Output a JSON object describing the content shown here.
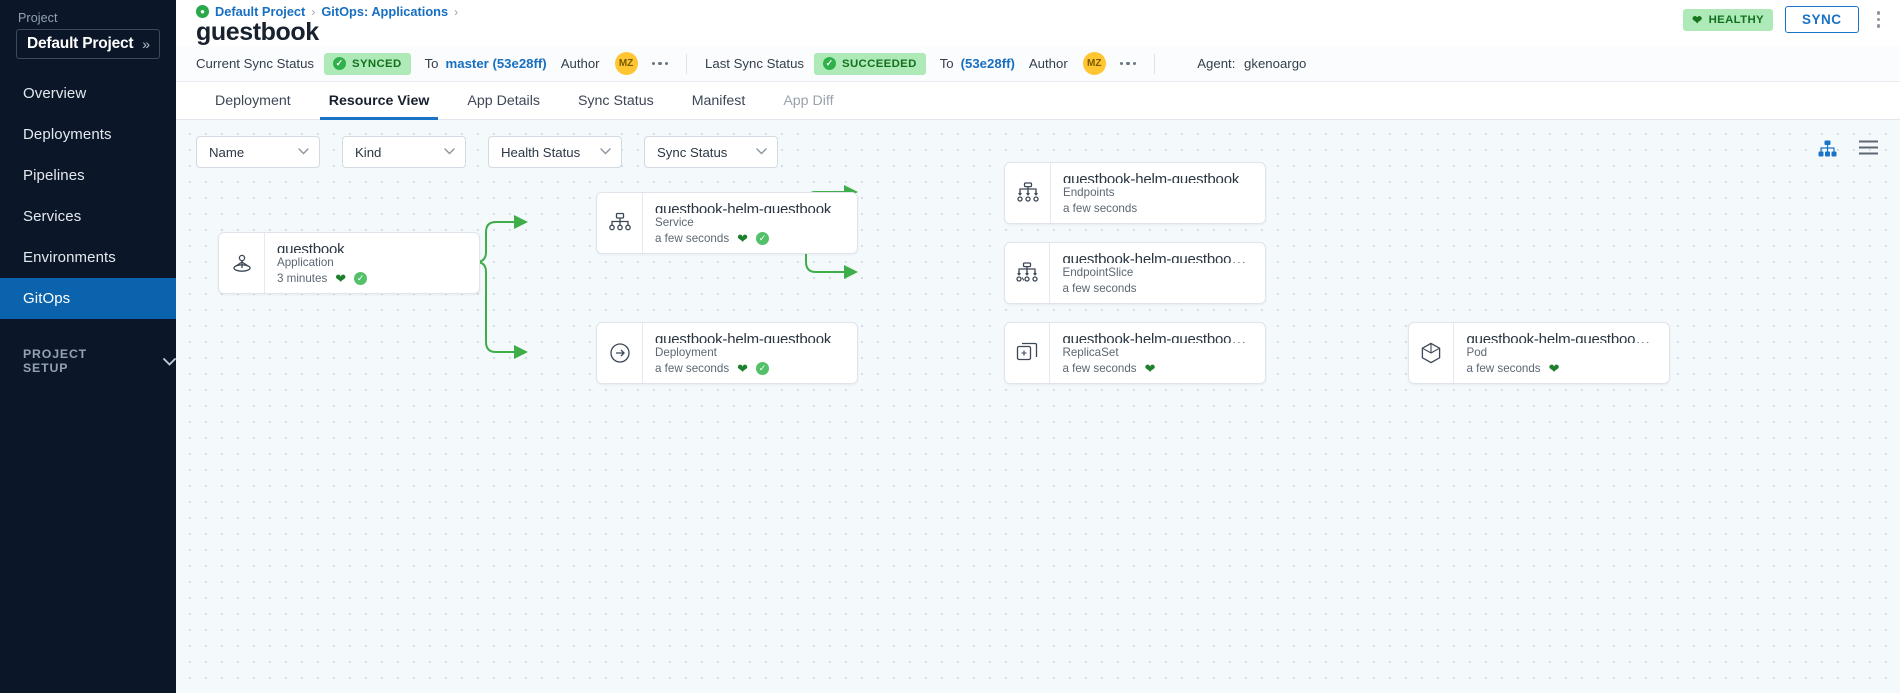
{
  "sidebar": {
    "project_label": "Project",
    "project_name": "Default Project",
    "expand_glyph": "»",
    "items": [
      {
        "label": "Overview"
      },
      {
        "label": "Deployments"
      },
      {
        "label": "Pipelines"
      },
      {
        "label": "Services"
      },
      {
        "label": "Environments"
      },
      {
        "label": "GitOps"
      }
    ],
    "active_item": "GitOps",
    "setup_label": "PROJECT SETUP",
    "setup_caret": "⌄"
  },
  "breadcrumb": {
    "items": [
      {
        "label": "Default Project"
      },
      {
        "label": "GitOps: Applications"
      }
    ],
    "separator": "›"
  },
  "header": {
    "title": "guestbook",
    "health_badge": "HEALTHY",
    "sync_button": "SYNC"
  },
  "status": {
    "current_sync_label": "Current Sync Status",
    "current_sync_value": "SYNCED",
    "current_to_label": "To",
    "current_to_value": "master (53e28ff)",
    "current_author_label": "Author",
    "current_author_initials": "MZ",
    "last_sync_label": "Last Sync Status",
    "last_sync_value": "SUCCEEDED",
    "last_to_label": "To",
    "last_to_value": "(53e28ff)",
    "last_author_label": "Author",
    "last_author_initials": "MZ",
    "agent_label": "Agent:",
    "agent_value": "gkenoargo"
  },
  "tabs": [
    {
      "label": "Deployment",
      "state": "normal"
    },
    {
      "label": "Resource View",
      "state": "active"
    },
    {
      "label": "App Details",
      "state": "normal"
    },
    {
      "label": "Sync Status",
      "state": "normal"
    },
    {
      "label": "Manifest",
      "state": "normal"
    },
    {
      "label": "App Diff",
      "state": "disabled"
    }
  ],
  "filters": [
    {
      "label": "Name"
    },
    {
      "label": "Kind"
    },
    {
      "label": "Health Status"
    },
    {
      "label": "Sync Status"
    }
  ],
  "view_toggles": [
    {
      "name": "tree-view-icon",
      "active": true
    },
    {
      "name": "list-view-icon",
      "active": false
    }
  ],
  "graph": {
    "nodes": [
      {
        "id": "application",
        "title": "guestbook",
        "kind": "Application",
        "age": "3 minutes",
        "health": true,
        "sync": true,
        "icon": "application-icon"
      },
      {
        "id": "service",
        "title": "guestbook-helm-guestbook",
        "kind": "Service",
        "age": "a few seconds",
        "health": true,
        "sync": true,
        "icon": "service-icon"
      },
      {
        "id": "deployment",
        "title": "guestbook-helm-guestbook",
        "kind": "Deployment",
        "age": "a few seconds",
        "health": true,
        "sync": true,
        "icon": "deployment-icon"
      },
      {
        "id": "endpoints",
        "title": "guestbook-helm-guestbook",
        "kind": "Endpoints",
        "age": "a few seconds",
        "health": false,
        "sync": false,
        "icon": "endpoints-icon"
      },
      {
        "id": "endpointslice",
        "title": "guestbook-helm-guestbook-...",
        "kind": "EndpointSlice",
        "age": "a few seconds",
        "health": false,
        "sync": false,
        "icon": "endpointslice-icon"
      },
      {
        "id": "replicaset",
        "title": "guestbook-helm-guestbook-...",
        "kind": "ReplicaSet",
        "age": "a few seconds",
        "health": true,
        "sync": false,
        "icon": "replicaset-icon"
      },
      {
        "id": "pod",
        "title": "guestbook-helm-guestbook-...",
        "kind": "Pod",
        "age": "a few seconds",
        "health": true,
        "sync": false,
        "icon": "pod-icon"
      }
    ]
  },
  "colors": {
    "accent": "#1a73c4",
    "sidebar_bg": "#0b1728",
    "healthy_green": "#1e7f2c",
    "badge_bg": "#aeeab8",
    "edge_green": "#3fae4a"
  }
}
